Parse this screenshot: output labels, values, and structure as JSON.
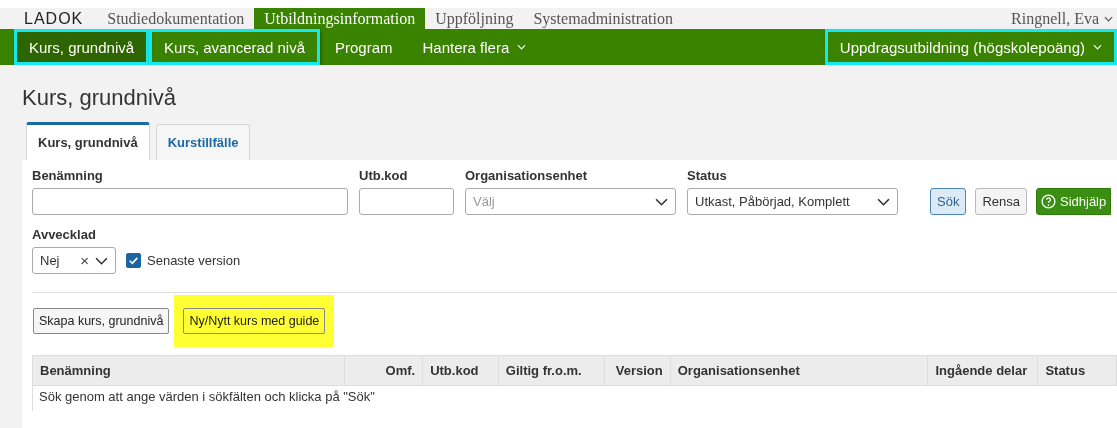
{
  "logo": "LADOK",
  "main_nav": [
    {
      "label": "Studiedokumentation",
      "selected": false
    },
    {
      "label": "Utbildningsinformation",
      "selected": true
    },
    {
      "label": "Uppföljning",
      "selected": false
    },
    {
      "label": "Systemadministration",
      "selected": false
    }
  ],
  "user_menu": {
    "label": "Ringnell, Eva"
  },
  "sub_nav": [
    {
      "label": "Kurs, grundnivå",
      "selected": true,
      "highlighted": true,
      "dropdown": false
    },
    {
      "label": "Kurs, avancerad nivå",
      "selected": false,
      "highlighted": true,
      "dropdown": false
    },
    {
      "label": "Program",
      "selected": false,
      "highlighted": false,
      "dropdown": false
    },
    {
      "label": "Hantera flera",
      "selected": false,
      "highlighted": false,
      "dropdown": true
    }
  ],
  "sub_nav_right": {
    "label": "Uppdragsutbildning (högskolepoäng)",
    "highlighted": true
  },
  "page_title": "Kurs, grundnivå",
  "tabs": [
    {
      "label": "Kurs, grundnivå",
      "selected": true
    },
    {
      "label": "Kurstillfälle",
      "selected": false
    }
  ],
  "filters": {
    "name": {
      "label": "Benämning"
    },
    "code": {
      "label": "Utb.kod"
    },
    "org": {
      "label": "Organisationsenhet",
      "placeholder": "Välj"
    },
    "status": {
      "label": "Status",
      "value": "Utkast, Påbörjad, Komplett"
    },
    "discontinued": {
      "label": "Avvecklad",
      "value": "Nej",
      "clear": "×"
    },
    "latest_version": {
      "label": "Senaste version",
      "checked": true
    }
  },
  "filter_buttons": [
    {
      "label": "Sök",
      "kind": "primary"
    },
    {
      "label": "Rensa",
      "kind": "default"
    },
    {
      "label": "Sidhjälp",
      "kind": "help"
    }
  ],
  "actions": [
    {
      "label": "Skapa kurs, grundnivå",
      "highlighted": false
    },
    {
      "label": "Ny/Nytt kurs med guide",
      "highlighted": true
    }
  ],
  "table": {
    "columns": [
      {
        "label": "Benämning",
        "kind": "text"
      },
      {
        "label": "Omf.",
        "kind": "numeric"
      },
      {
        "label": "Utb.kod",
        "kind": "text"
      },
      {
        "label": "Giltig fr.o.m.",
        "kind": "text"
      },
      {
        "label": "Version",
        "kind": "numeric"
      },
      {
        "label": "Organisationsenhet",
        "kind": "text"
      },
      {
        "label": "Ingående delar",
        "kind": "text"
      },
      {
        "label": "Status",
        "kind": "text"
      }
    ],
    "empty_message": "Sök genom att ange värden i sökfälten och klicka på \"Sök\""
  }
}
